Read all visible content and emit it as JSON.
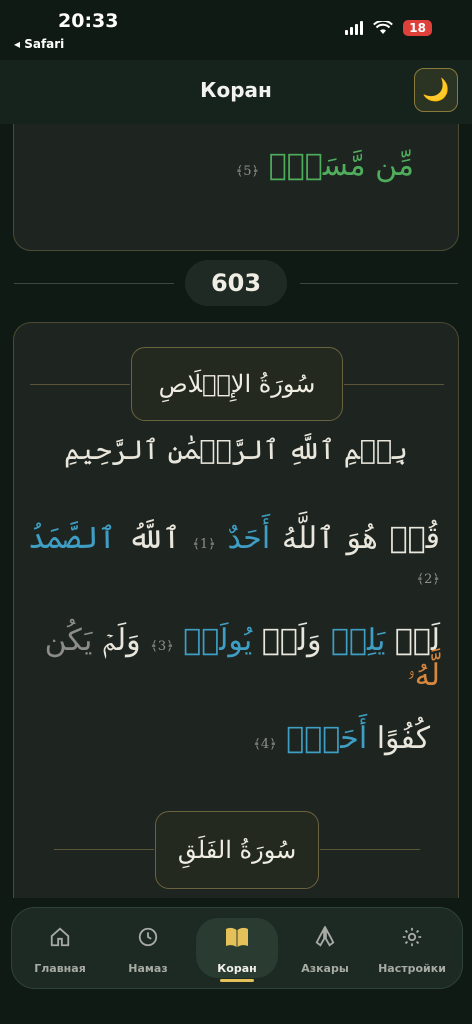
{
  "status_bar": {
    "time": "20:33",
    "back_app": "◂ Safari",
    "battery": "18"
  },
  "header": {
    "title": "Коран",
    "theme_icon": "moon-icon"
  },
  "top_card": {
    "verse_words": [
      "مِّن",
      "مَّسَدِۭ"
    ],
    "ayah_marker": "﴿5﴾"
  },
  "page_number": "603",
  "surah_1": {
    "title": "سُورَةُ الإِخۡلَاصِ",
    "basmala": "بِسۡمِ ٱللَّهِ ٱلرَّحۡمَٰنِ ٱلرَّحِيمِ",
    "line1": {
      "w1": "قُلۡ",
      "w2": "هُوَ",
      "w3": "ٱللَّهُ",
      "w4": "أَحَدٌ",
      "m1": "﴿1﴾",
      "w5": "ٱللَّهُ",
      "w6": "ٱلصَّمَدُ",
      "m2": "﴿2﴾"
    },
    "line2": {
      "w1": "لَمۡ",
      "w2": "يَلِدۡ",
      "w3": "وَلَمۡ",
      "w4": "يُولَدۡ",
      "m3": "﴿3﴾",
      "w5": "وَلَمۡ",
      "w6": "يَكُن",
      "w7": "لَّهُۥ"
    },
    "line3": {
      "w1": "كُفُوًا",
      "w2": "أَحَدُۢ",
      "m4": "﴿4﴾"
    }
  },
  "surah_2": {
    "title": "سُورَةُ الفَلَقِ"
  },
  "tabs": [
    {
      "label": "Главная",
      "icon": "home-icon"
    },
    {
      "label": "Намаз",
      "icon": "clock-icon"
    },
    {
      "label": "Коран",
      "icon": "book-icon"
    },
    {
      "label": "Азкары",
      "icon": "praying-hands-icon"
    },
    {
      "label": "Настройки",
      "icon": "gear-icon"
    }
  ],
  "colors": {
    "accent": "#e5c15a",
    "tajweed_green": "#4fae5c",
    "tajweed_blue": "#3f9ec4",
    "tajweed_orange": "#d8873e"
  }
}
